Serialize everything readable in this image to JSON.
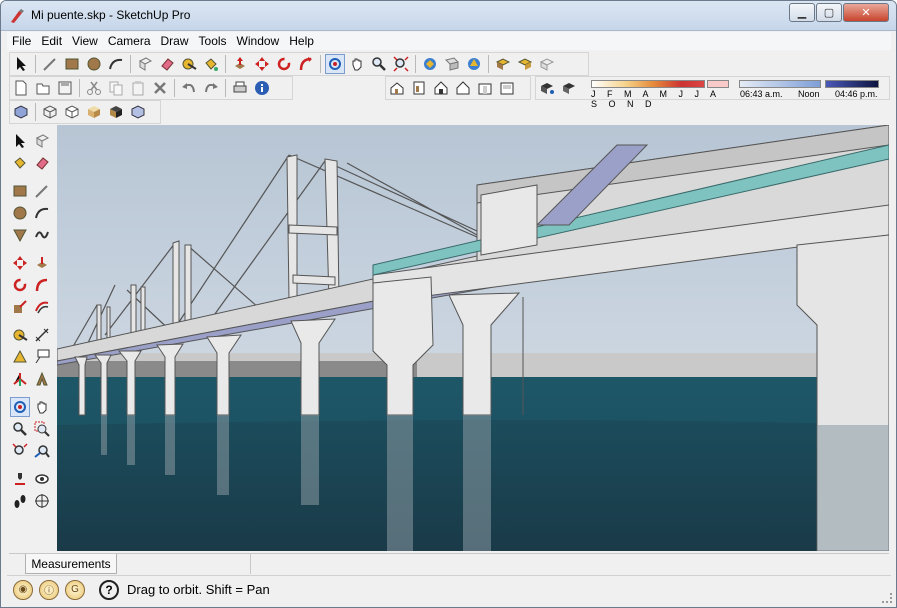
{
  "window": {
    "title": "Mi puente.skp - SketchUp Pro",
    "minimize": "▁",
    "maximize": "▢",
    "close": "✕"
  },
  "menu": [
    "File",
    "Edit",
    "View",
    "Camera",
    "Draw",
    "Tools",
    "Window",
    "Help"
  ],
  "shadow": {
    "months": "J F M A M J J A S O N D",
    "time_start": "06:43 a.m.",
    "time_mid": "Noon",
    "time_end": "04:46 p.m."
  },
  "measurements": {
    "label": "Measurements",
    "value": ""
  },
  "status": {
    "help_glyph": "?",
    "text": "Drag to orbit.  Shift = Pan"
  },
  "colors": {
    "water": "#1e4a5a",
    "sky": "#c9d5e0",
    "deck": "#d8d8d8",
    "glass": "#7ec3c0"
  },
  "icons": {
    "top1": [
      "select-icon",
      "eraser-icon",
      "paint-icon",
      "rectangle-icon",
      "circle-icon",
      "arc-icon",
      "make-component-icon",
      "erase-icon",
      "tape-icon",
      "paint-bucket-icon",
      "push-pull-icon",
      "move-icon",
      "rotate-icon",
      "follow-me-icon",
      "orbit-icon",
      "pan-icon",
      "zoom-icon",
      "zoom-extents-icon",
      "get-models-icon",
      "share-model-icon",
      "share-component-icon",
      "photo-textures-icon",
      "preview-google-earth-icon",
      "toggle-terrain-icon"
    ],
    "top2": [
      "new-icon",
      "open-icon",
      "save-icon",
      "cut-icon",
      "copy-icon",
      "paste-icon",
      "delete-icon",
      "undo-icon",
      "redo-icon",
      "print-icon",
      "model-info-icon"
    ],
    "views": [
      "iso-view-icon",
      "top-view-icon",
      "front-view-icon",
      "right-view-icon",
      "back-view-icon",
      "left-view-icon"
    ],
    "shadows": [
      "shadow-settings-icon",
      "display-shadows-icon"
    ],
    "styles": [
      "xray-icon",
      "wireframe-icon",
      "hidden-line-icon",
      "shaded-icon",
      "shaded-texture-icon",
      "monochrome-icon"
    ]
  }
}
